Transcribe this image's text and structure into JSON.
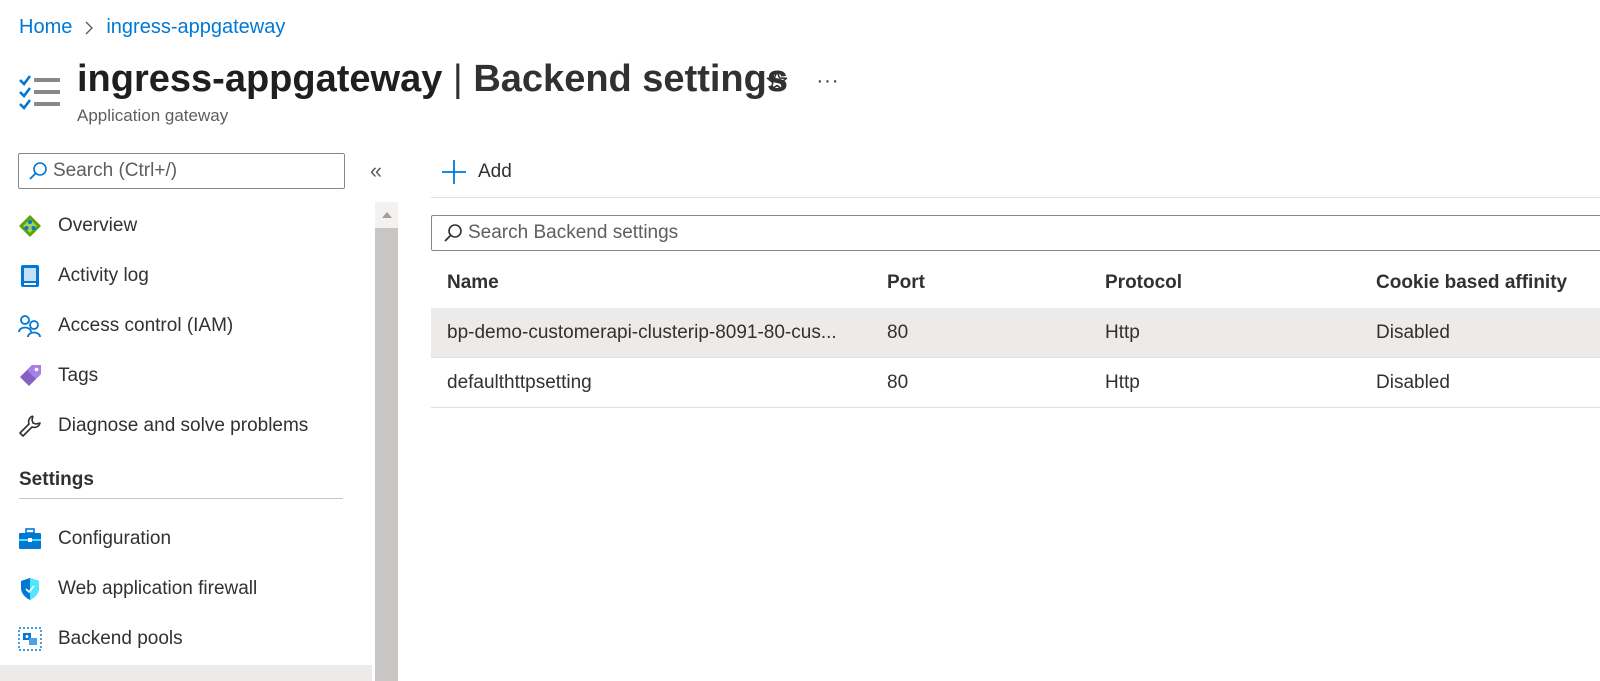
{
  "breadcrumb": {
    "home": "Home",
    "resource": "ingress-appgateway"
  },
  "header": {
    "resource_name": "ingress-appgateway",
    "separator": "|",
    "blade_title": "Backend settings",
    "subtitle": "Application gateway",
    "favorite_icon": "star-icon",
    "more_label": "···"
  },
  "sidebar": {
    "search_placeholder": "Search (Ctrl+/)",
    "collapse_label": "«",
    "items": [
      {
        "label": "Overview",
        "icon": "overview-icon"
      },
      {
        "label": "Activity log",
        "icon": "activity-log-icon"
      },
      {
        "label": "Access control (IAM)",
        "icon": "iam-icon"
      },
      {
        "label": "Tags",
        "icon": "tag-icon"
      },
      {
        "label": "Diagnose and solve problems",
        "icon": "wrench-icon"
      }
    ],
    "section_title": "Settings",
    "settings_items": [
      {
        "label": "Configuration",
        "icon": "toolbox-icon"
      },
      {
        "label": "Web application firewall",
        "icon": "shield-icon"
      },
      {
        "label": "Backend pools",
        "icon": "backend-pool-icon"
      }
    ]
  },
  "toolbar": {
    "add_label": "Add"
  },
  "grid": {
    "search_placeholder": "Search Backend settings",
    "columns": [
      "Name",
      "Port",
      "Protocol",
      "Cookie based affinity"
    ],
    "rows": [
      {
        "name": "bp-demo-customerapi-clusterip-8091-80-cus...",
        "port": "80",
        "protocol": "Http",
        "affinity": "Disabled"
      },
      {
        "name": "defaulthttpsetting",
        "port": "80",
        "protocol": "Http",
        "affinity": "Disabled"
      }
    ]
  },
  "colors": {
    "link": "#0078d4",
    "text": "#323130",
    "selected_row": "#edebe9"
  }
}
